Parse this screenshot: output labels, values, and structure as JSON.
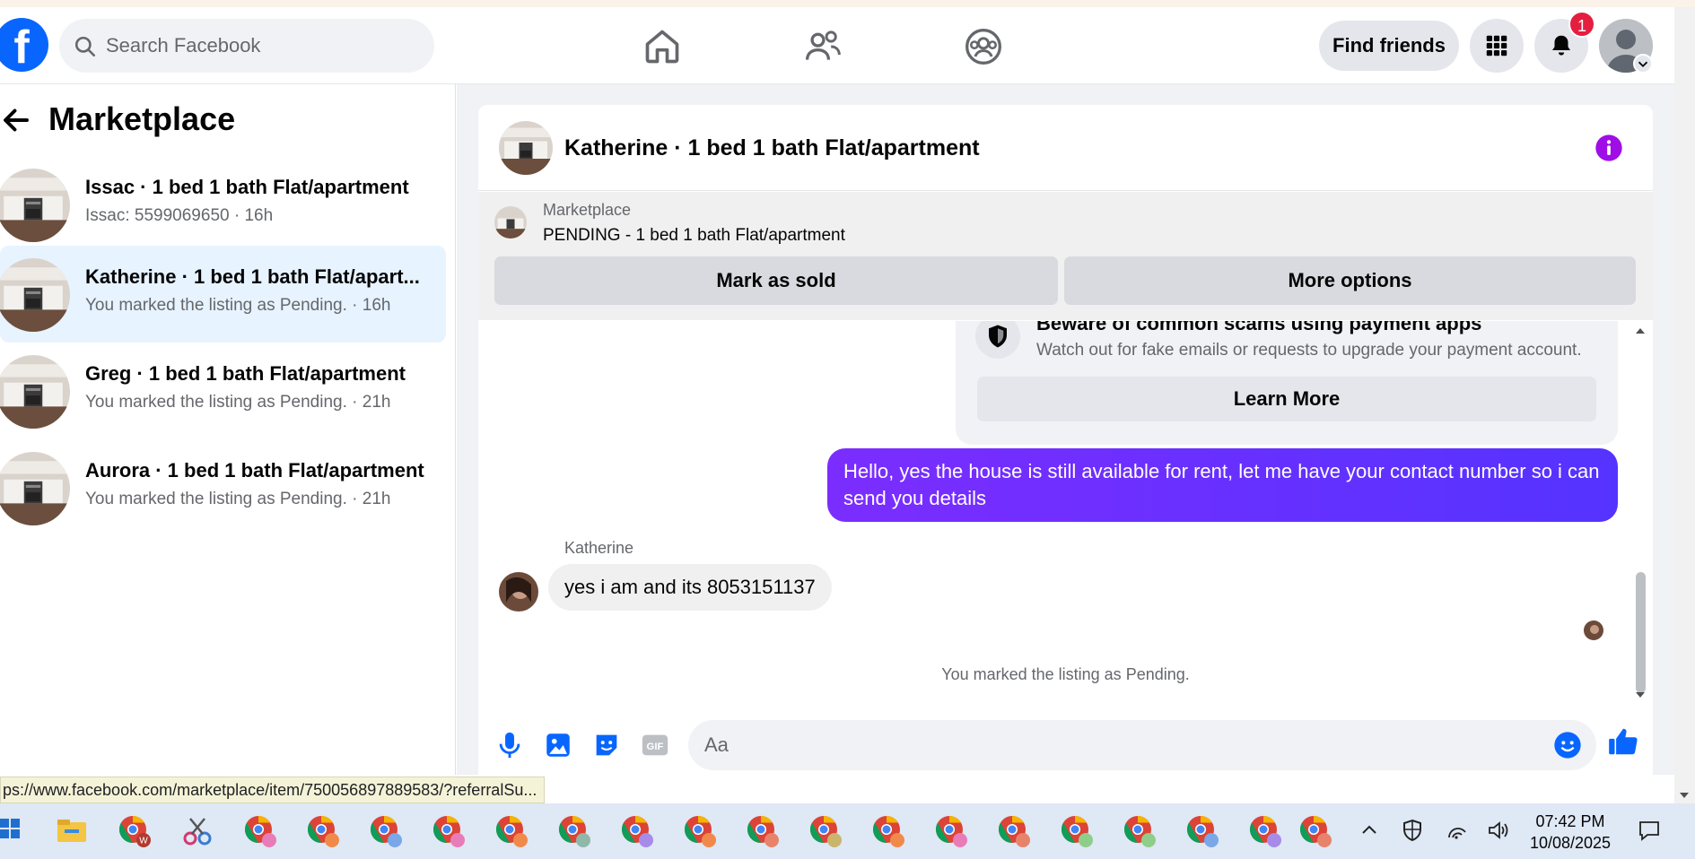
{
  "search": {
    "placeholder": "Search Facebook"
  },
  "topnav": {
    "find_friends": "Find friends",
    "notification_count": "1",
    "icons": [
      "home-icon",
      "friends-icon",
      "groups-icon",
      "menu-grid-icon",
      "bell-icon",
      "profile-avatar"
    ]
  },
  "sidebar": {
    "title": "Marketplace",
    "conversations": [
      {
        "title": "Issac · 1 bed 1 bath Flat/apartment",
        "sub": "Issac: 5599069650 · 16h",
        "active": false
      },
      {
        "title": "Katherine · 1 bed 1 bath Flat/apart...",
        "sub": "You marked the listing as Pending. · 16h",
        "active": true
      },
      {
        "title": "Greg · 1 bed 1 bath Flat/apartment",
        "sub": "You marked the listing as Pending. · 21h",
        "active": false
      },
      {
        "title": "Aurora · 1 bed 1 bath Flat/apartment",
        "sub": "You marked the listing as Pending. · 21h",
        "active": false
      }
    ]
  },
  "chat": {
    "header_title": "Katherine · 1 bed 1 bath Flat/apartment",
    "pinned": {
      "label": "Marketplace",
      "status": "PENDING - 1 bed 1 bath Flat/apartment",
      "mark_sold": "Mark as sold",
      "more_options": "More options"
    },
    "scam_card": {
      "title": "Beware of common scams using payment apps",
      "desc": "Watch out for fake emails or requests to upgrade your payment account.",
      "button": "Learn More"
    },
    "outgoing": "Hello, yes the house is still available for rent, let me have your contact number so i can send you details",
    "incoming_sender": "Katherine",
    "incoming": "yes i am and its 8053151137",
    "system_note": "You marked the listing as Pending.",
    "composer_placeholder": "Aa"
  },
  "status_url": "ps://www.facebook.com/marketplace/item/750056897889583/?referralSu...",
  "taskbar": {
    "time": "07:42 PM",
    "date": "10/08/2025"
  },
  "colors": {
    "brand": "#0866ff",
    "outgoing_bubble": "#6a2dff",
    "badge": "#e41e3f",
    "info": "#9f0ee6"
  }
}
